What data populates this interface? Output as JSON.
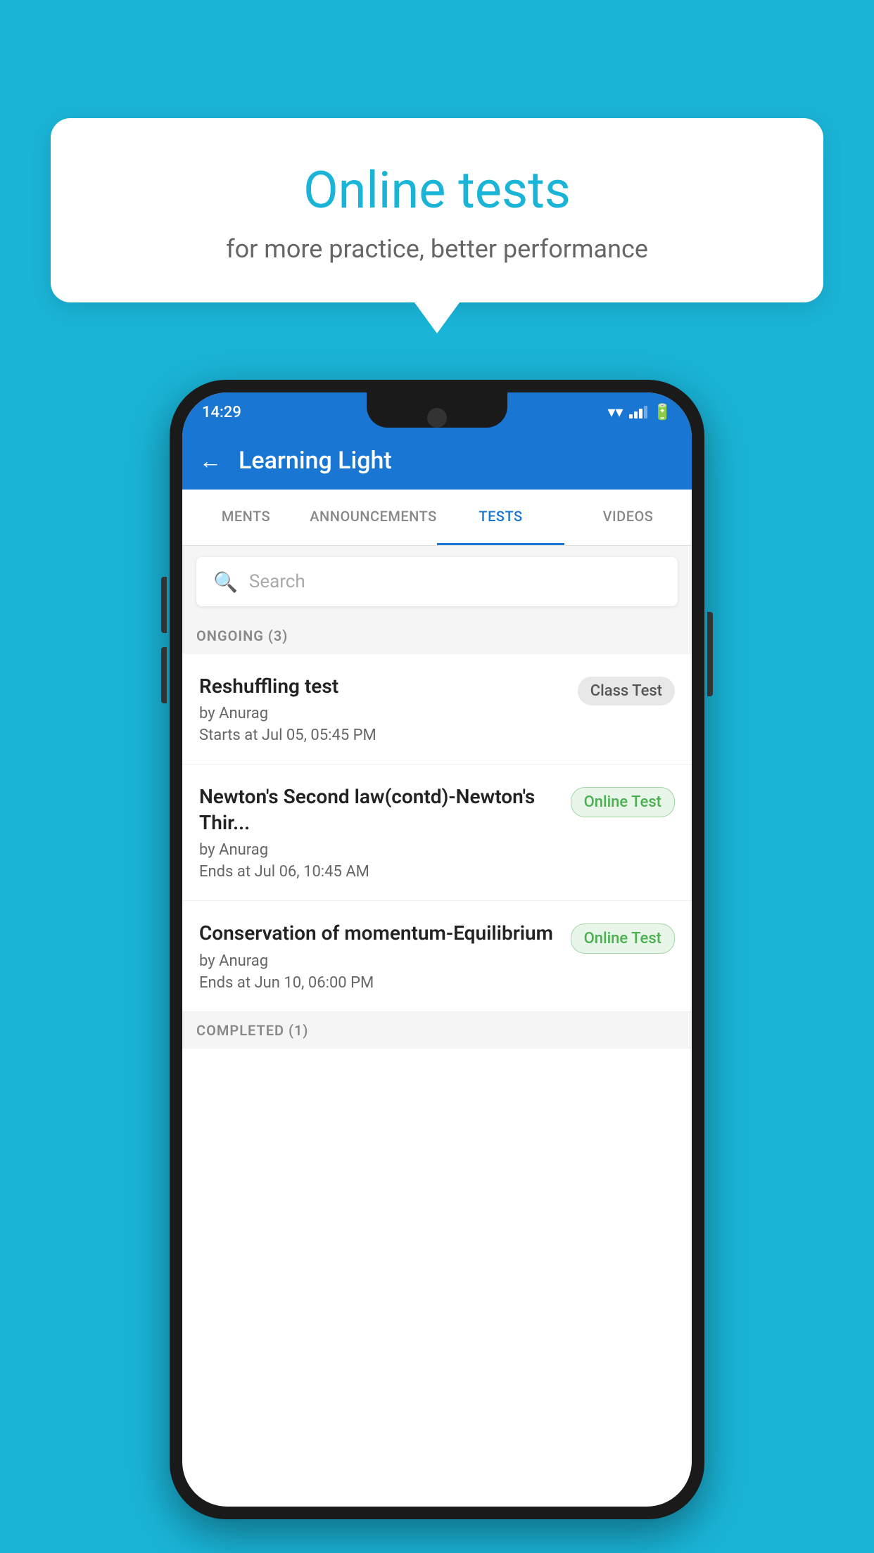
{
  "background": {
    "color": "#1ab4d7"
  },
  "speech_bubble": {
    "title": "Online tests",
    "subtitle": "for more practice, better performance"
  },
  "phone": {
    "status_bar": {
      "time": "14:29",
      "wifi": "▾",
      "battery": "▮"
    },
    "app_bar": {
      "title": "Learning Light",
      "back_label": "←"
    },
    "tabs": [
      {
        "label": "MENTS",
        "active": false
      },
      {
        "label": "ANNOUNCEMENTS",
        "active": false
      },
      {
        "label": "TESTS",
        "active": true
      },
      {
        "label": "VIDEOS",
        "active": false
      }
    ],
    "search": {
      "placeholder": "Search"
    },
    "sections": {
      "ongoing": {
        "label": "ONGOING (3)",
        "tests": [
          {
            "title": "Reshuffling test",
            "by": "by Anurag",
            "date": "Starts at  Jul 05, 05:45 PM",
            "badge": "Class Test",
            "badge_type": "class"
          },
          {
            "title": "Newton's Second law(contd)-Newton's Thir...",
            "by": "by Anurag",
            "date": "Ends at  Jul 06, 10:45 AM",
            "badge": "Online Test",
            "badge_type": "online"
          },
          {
            "title": "Conservation of momentum-Equilibrium",
            "by": "by Anurag",
            "date": "Ends at  Jun 10, 06:00 PM",
            "badge": "Online Test",
            "badge_type": "online"
          }
        ]
      },
      "completed": {
        "label": "COMPLETED (1)"
      }
    }
  }
}
